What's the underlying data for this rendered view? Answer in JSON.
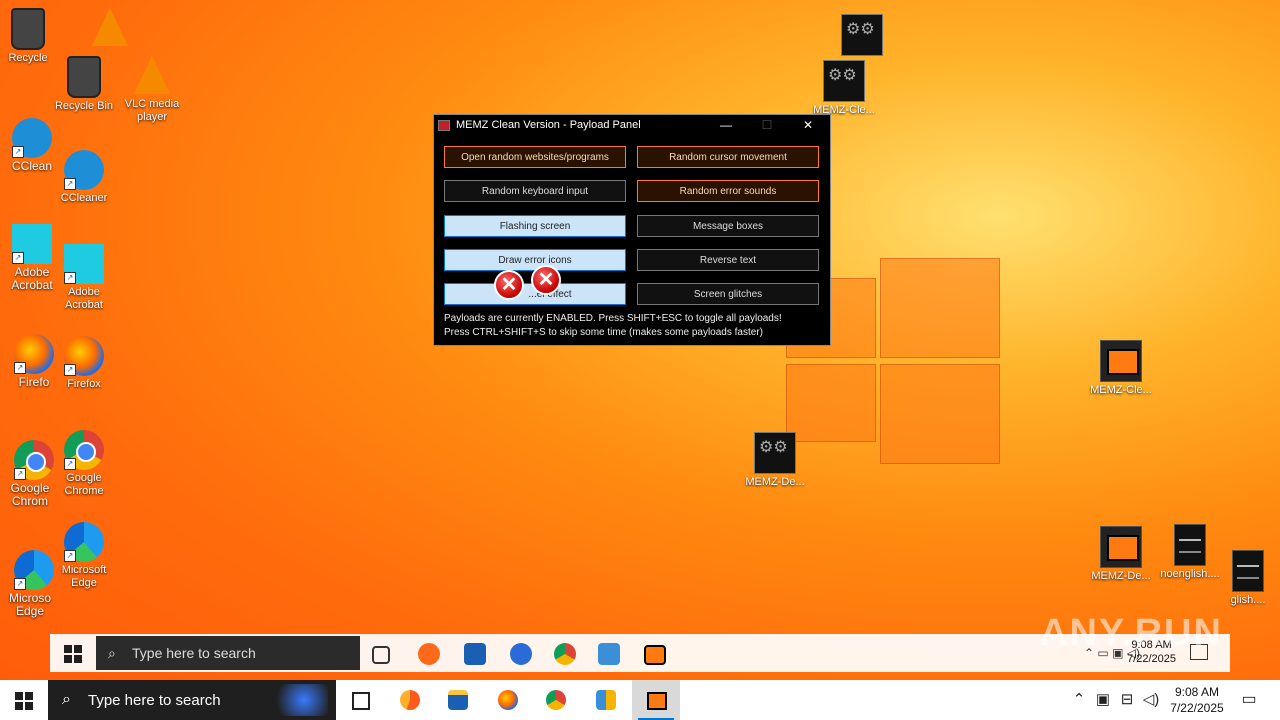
{
  "desktop": {
    "icons": [
      {
        "label": "Recycle",
        "kind": "bin"
      },
      {
        "label": "Recycle Bin",
        "kind": "bin"
      },
      {
        "label": "VLC media player",
        "kind": "vlc"
      },
      {
        "label": "CClean",
        "kind": "ccleaner"
      },
      {
        "label": "CCleaner",
        "kind": "ccleaner"
      },
      {
        "label": "Adobe Acrobat",
        "kind": "acrobat"
      },
      {
        "label": "Adobe Acrobat",
        "kind": "acrobat"
      },
      {
        "label": "Firefo",
        "kind": "firefox"
      },
      {
        "label": "Firefox",
        "kind": "firefox"
      },
      {
        "label": "Google Chrom",
        "kind": "chrome"
      },
      {
        "label": "Google Chrome",
        "kind": "chrome"
      },
      {
        "label": "Microso Edge",
        "kind": "edge"
      },
      {
        "label": "Microsoft Edge",
        "kind": "edge"
      },
      {
        "label": "MEMZ-Cle...",
        "kind": "gear"
      },
      {
        "label": "MEMZ-Cle...",
        "kind": "memz-clean"
      },
      {
        "label": "MEMZ-De...",
        "kind": "gear"
      },
      {
        "label": "MEMZ-De...",
        "kind": "memz-clean"
      },
      {
        "label": "noenglish....",
        "kind": "doc"
      },
      {
        "label": "glish....",
        "kind": "doc"
      }
    ]
  },
  "memz_window": {
    "title": "MEMZ Clean Version - Payload Panel",
    "minimize": "—",
    "maximize": "☐",
    "close": "✕",
    "buttons": [
      {
        "label": "Open random websites/programs",
        "state": "orange"
      },
      {
        "label": "Random cursor movement",
        "state": "orange"
      },
      {
        "label": "Random keyboard input",
        "state": "off"
      },
      {
        "label": "Random error sounds",
        "state": "orange"
      },
      {
        "label": "Flashing screen",
        "state": "blue"
      },
      {
        "label": "Message boxes",
        "state": "off"
      },
      {
        "label": "Draw error icons",
        "state": "blue"
      },
      {
        "label": "Reverse text",
        "state": "off"
      },
      {
        "label": "...el effect",
        "state": "blue"
      },
      {
        "label": "Screen glitches",
        "state": "off"
      }
    ],
    "status_line1": "Payloads are currently ENABLED. Press SHIFT+ESC to toggle all payloads!",
    "status_line2": "Press CTRL+SHIFT+S to skip some time (makes some payloads faster)"
  },
  "ghost_taskbar": {
    "search_placeholder": "Type here to search",
    "time": "9:08 AM",
    "date": "7/22/2025",
    "watermark": "ANY.RUN"
  },
  "taskbar": {
    "search_placeholder": "Type here to search",
    "time": "9:08 AM",
    "date": "7/22/2025",
    "icons": [
      "task-view-icon",
      "edge-icon",
      "file-explorer-icon",
      "firefox-icon",
      "chrome-icon",
      "app-icon",
      "memz-icon"
    ]
  },
  "colors": {
    "wallpaper_orange": "#ff6b0c",
    "enabled_border": "#ff7b22",
    "selected_blue": "#cce4f7",
    "accent": "#0078d7"
  }
}
